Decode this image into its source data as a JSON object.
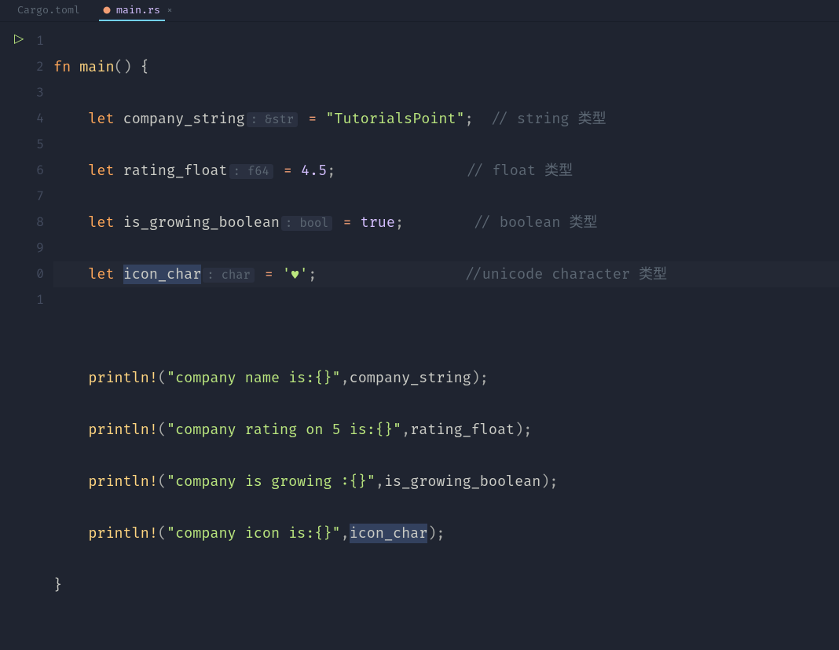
{
  "tabs": [
    {
      "label": "Cargo.toml",
      "active": false
    },
    {
      "label": "main.rs",
      "active": true,
      "dirty": true
    }
  ],
  "run_icon": "▷",
  "lines": [
    "1",
    "2",
    "3",
    "4",
    "5",
    "6",
    "7",
    "8",
    "9",
    "0",
    "1"
  ],
  "code": {
    "l1": {
      "kw": "fn",
      "name": "main",
      "parens": "()",
      "brace": "{"
    },
    "l2": {
      "kw": "let",
      "var": "company_string",
      "hint": ": &str",
      "eq": "=",
      "val": "\"TutorialsPoint\"",
      "semi": ";",
      "cmt": "// string 类型"
    },
    "l3": {
      "kw": "let",
      "var": "rating_float",
      "hint": ": f64",
      "eq": "=",
      "val": "4.5",
      "semi": ";",
      "cmt": "// float 类型"
    },
    "l4": {
      "kw": "let",
      "var": "is_growing_boolean",
      "hint": ": bool",
      "eq": "=",
      "val": "true",
      "semi": ";",
      "cmt": "// boolean 类型"
    },
    "l5": {
      "kw": "let",
      "var": "icon_char",
      "hint": ": char",
      "eq": "=",
      "val": "'♥'",
      "semi": ";",
      "cmt": "//unicode character 类型"
    },
    "l7": {
      "mac": "println!",
      "open": "(",
      "str": "\"company name is:{}\"",
      "comma": ",",
      "arg": "company_string",
      "close": ");"
    },
    "l8": {
      "mac": "println!",
      "open": "(",
      "str": "\"company rating on 5 is:{}\"",
      "comma": ",",
      "arg": "rating_float",
      "close": ");"
    },
    "l9": {
      "mac": "println!",
      "open": "(",
      "str": "\"company is growing :{}\"",
      "comma": ",",
      "arg": "is_growing_boolean",
      "close": ");"
    },
    "l10": {
      "mac": "println!",
      "open": "(",
      "str": "\"company icon is:{}\"",
      "comma": ",",
      "arg": "icon_char",
      "close": ");"
    },
    "l11": {
      "brace": "}"
    }
  }
}
